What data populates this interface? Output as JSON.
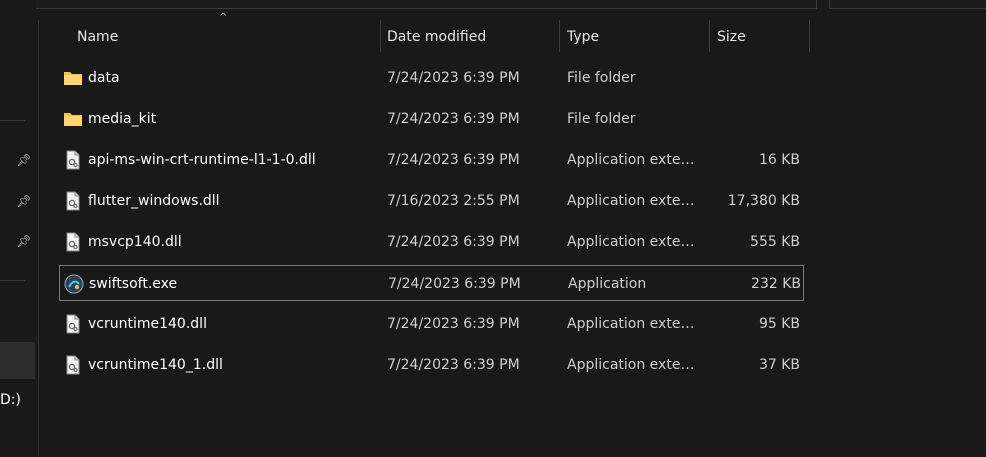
{
  "columns": {
    "name": "Name",
    "date_modified": "Date modified",
    "type": "Type",
    "size": "Size"
  },
  "nav": {
    "drive_label": "D:)"
  },
  "files": [
    {
      "name": "data",
      "date": "7/24/2023 6:39 PM",
      "type": "File folder",
      "size": "",
      "icon": "folder-icon"
    },
    {
      "name": "media_kit",
      "date": "7/24/2023 6:39 PM",
      "type": "File folder",
      "size": "",
      "icon": "folder-icon"
    },
    {
      "name": "api-ms-win-crt-runtime-l1-1-0.dll",
      "date": "7/24/2023 6:39 PM",
      "type": "Application extens...",
      "size": "16 KB",
      "icon": "dll-file-icon"
    },
    {
      "name": "flutter_windows.dll",
      "date": "7/16/2023 2:55 PM",
      "type": "Application extens...",
      "size": "17,380 KB",
      "icon": "dll-file-icon"
    },
    {
      "name": "msvcp140.dll",
      "date": "7/24/2023 6:39 PM",
      "type": "Application extens...",
      "size": "555 KB",
      "icon": "dll-file-icon"
    },
    {
      "name": "swiftsoft.exe",
      "date": "7/24/2023 6:39 PM",
      "type": "Application",
      "size": "232 KB",
      "icon": "app-exe-icon",
      "selected": true
    },
    {
      "name": "vcruntime140.dll",
      "date": "7/24/2023 6:39 PM",
      "type": "Application extens...",
      "size": "95 KB",
      "icon": "dll-file-icon"
    },
    {
      "name": "vcruntime140_1.dll",
      "date": "7/24/2023 6:39 PM",
      "type": "Application extens...",
      "size": "37 KB",
      "icon": "dll-file-icon"
    }
  ],
  "colors": {
    "background": "#191919",
    "folder": "#f4c542",
    "selection_border": "#7a7a7a"
  }
}
